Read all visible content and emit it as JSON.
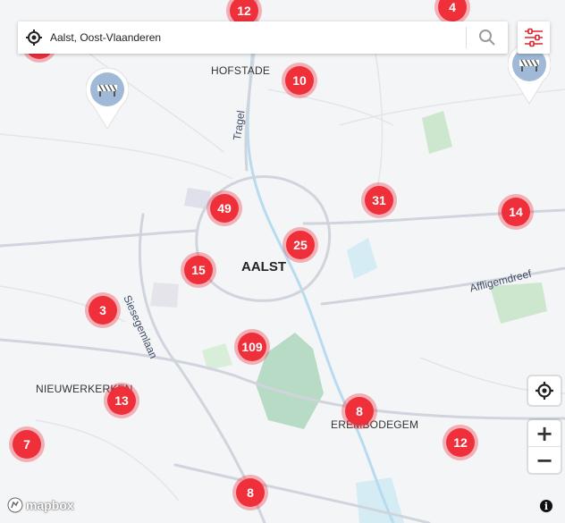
{
  "search": {
    "value": "Aalst, Oost-Vlaanderen",
    "placeholder": ""
  },
  "places": {
    "hofstade": "HOFSTADE",
    "aalst": "AALST",
    "nieuwerkerken": "NIEUWERKERKEN",
    "erembodegem": "EREMBODEGEM"
  },
  "roads": {
    "tragel": "Tragel",
    "siesegemlaan": "Siesegemlaan",
    "affligemdreef": "Affligemdreef"
  },
  "clusters": [
    "12",
    "4",
    "10",
    "31",
    "14",
    "49",
    "25",
    "15",
    "3",
    "109",
    "13",
    "8",
    "7",
    "12",
    "8"
  ],
  "controls": {
    "zoom_in": "+",
    "zoom_out": "−",
    "info": "i"
  },
  "attribution": "mapbox",
  "colors": {
    "cluster": "#ef2f3a",
    "accent": "#e0242f",
    "pin": "#9fb9d6"
  },
  "icons": {
    "locate": "crosshair-icon",
    "search": "search-icon",
    "filter": "sliders-icon",
    "pin": "roadworks-pin-icon"
  }
}
